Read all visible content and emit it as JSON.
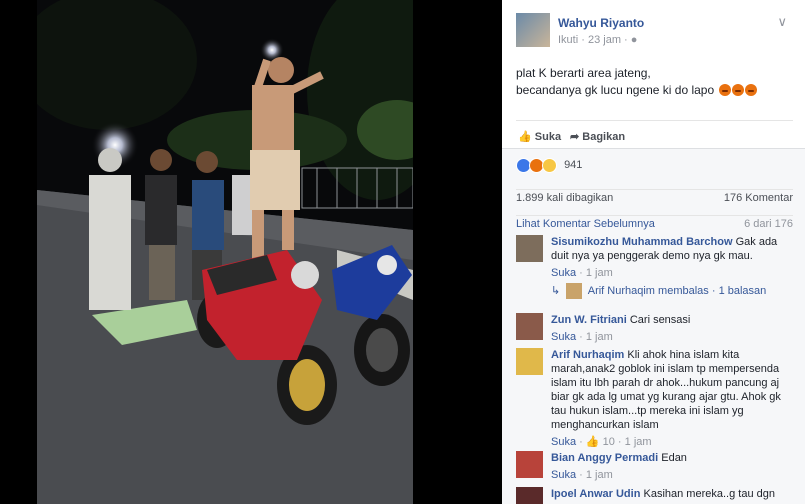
{
  "post": {
    "author": "Wahyu Riyanto",
    "follow": "Ikuti",
    "time": "23 jam",
    "text_line1": "plat K berarti area jateng,",
    "text_line2": "becandanya gk lucu ngene ki do lapo",
    "like_label": "Suka",
    "share_label": "Bagikan",
    "reaction_count": "941",
    "shares_text": "1.899 kali dibagikan",
    "comments_count": "176 Komentar",
    "prev_comments": "Lihat Komentar Sebelumnya",
    "comments_page": "6 dari 176"
  },
  "comments": [
    {
      "name": "Sisumikozhu Muhammad Barchow",
      "text": "Gak ada duit nya ya penggerak demo nya gk mau.",
      "like": "Suka",
      "time": "1 jam"
    },
    {
      "name": "Zun W. Fitriani",
      "text": "Cari sensasi",
      "like": "Suka",
      "time": "1 jam"
    },
    {
      "name": "Arif Nurhaqim",
      "text": "Kli ahok hina islam kita marah,anak2 goblok ini islam tp mempersenda islam itu lbh parah dr ahok...hukum pancung aj biar gk ada lg umat yg kurang ajar gtu. Ahok gk tau hukun islam...tp mereka ini islam yg menghancurkan islam",
      "like": "Suka",
      "likes": "10",
      "time": "1 jam"
    },
    {
      "name": "Bian Anggy Permadi",
      "text": "Edan",
      "like": "Suka",
      "time": "1 jam"
    },
    {
      "name": "Ipoel Anwar Udin",
      "text": "Kasihan mereka..g tau dgn apa"
    }
  ],
  "reply": {
    "name": "Arif Nurhaqim",
    "action": "membalas",
    "count": "1 balasan"
  },
  "colors": {
    "link": "#365899",
    "grey_text": "#90949c",
    "background": "#f6f7f9"
  }
}
